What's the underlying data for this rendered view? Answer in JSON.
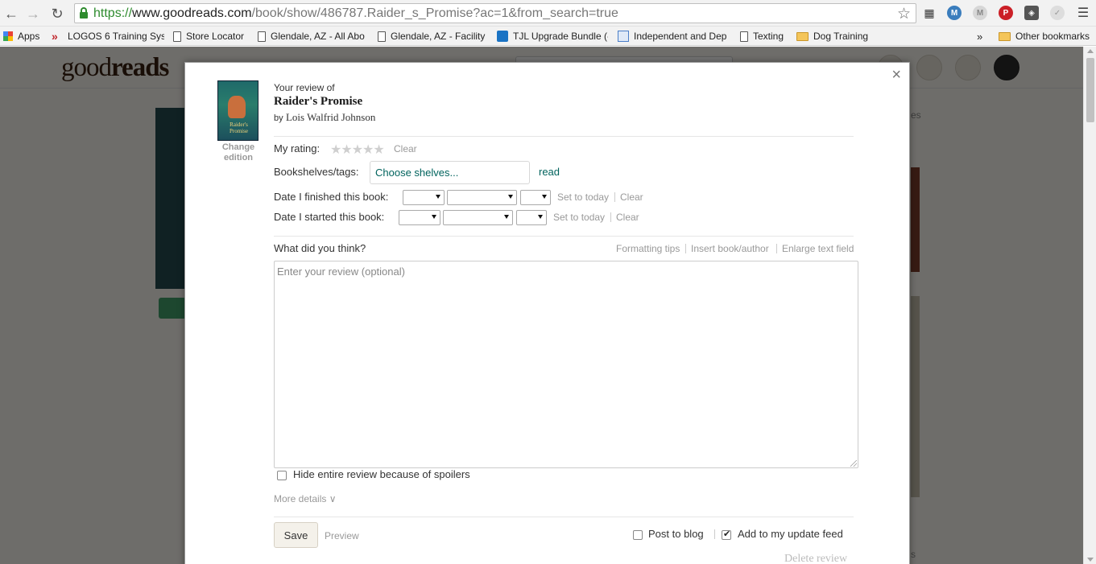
{
  "browser": {
    "url_proto": "https://",
    "url_host": "www.goodreads.com",
    "url_path": "/book/show/486787.Raider_s_Promise?ac=1&from_search=true",
    "bookmarks": [
      {
        "label": "Apps"
      },
      {
        "label": "LOGOS 6 Training Sys"
      },
      {
        "label": "Store Locator"
      },
      {
        "label": "Glendale, AZ - All Abo"
      },
      {
        "label": "Glendale, AZ - Facility"
      },
      {
        "label": "TJL Upgrade Bundle (-"
      },
      {
        "label": "Independent and Dep"
      },
      {
        "label": "Texting"
      },
      {
        "label": "Dog Training"
      }
    ],
    "overflow_label": "»",
    "other_bookmarks": "Other bookmarks"
  },
  "site": {
    "logo_good": "good",
    "logo_reads": "reads",
    "side_text": "es",
    "side_text2": "s"
  },
  "modal": {
    "close_label": "×",
    "cover_title": "Raider's Promise",
    "change_edition": "Change edition",
    "review_of_label": "Your review of",
    "book_title": "Raider's Promise",
    "by_label": "by",
    "author": "Lois Walfrid Johnson",
    "my_rating_label": "My rating:",
    "stars": "★★★★★",
    "rating_clear": "Clear",
    "shelves_label": "Bookshelves/tags:",
    "shelves_placeholder": "Choose shelves...",
    "shelf_value": "read",
    "finished_label": "Date I finished this book:",
    "started_label": "Date I started this book:",
    "set_to_today": "Set to today",
    "date_clear": "Clear",
    "what_think_label": "What did you think?",
    "formatting_tips": "Formatting tips",
    "insert_book_author": "Insert book/author",
    "enlarge_text_field": "Enlarge text field",
    "review_placeholder": "Enter your review (optional)",
    "spoiler_label": "Hide entire review because of spoilers",
    "spoiler_checked": false,
    "more_details": "More details ∨",
    "save_label": "Save",
    "preview_label": "Preview",
    "post_to_blog_label": "Post to blog",
    "post_to_blog_checked": false,
    "update_feed_label": "Add to my update feed",
    "update_feed_checked": true,
    "delete_review": "Delete review"
  }
}
